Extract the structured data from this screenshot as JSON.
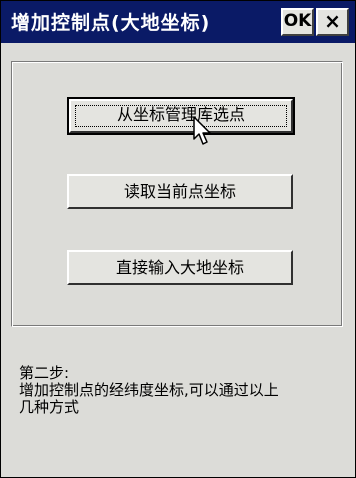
{
  "window": {
    "title": "增加控制点(大地坐标)",
    "ok_label": "OK",
    "close_label": "×"
  },
  "options": {
    "from_coord_manager": "从坐标管理库选点",
    "read_current_point": "读取当前点坐标",
    "direct_input": "直接输入大地坐标"
  },
  "info": {
    "step": "第二步:",
    "line1": "增加控制点的经纬度坐标,可以通过以上",
    "line2": "几种方式"
  },
  "colors": {
    "titlebar": "#0a1a66",
    "window_bg": "#dcdcd8"
  },
  "icons": {
    "cursor": "mouse-pointer-icon"
  }
}
